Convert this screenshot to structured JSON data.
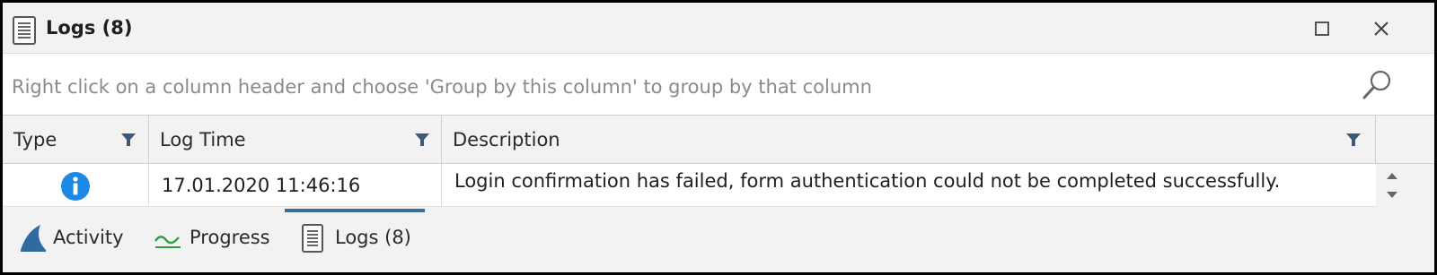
{
  "window": {
    "title": "Logs (8)",
    "icons": {
      "title": "document-lines-icon",
      "maximize": "maximize-icon",
      "close": "close-icon"
    }
  },
  "group_panel": {
    "hint": "Right click on a column header and choose 'Group by this column' to group by that column",
    "search_icon": "search-icon"
  },
  "grid": {
    "columns": [
      {
        "label": "Type",
        "filter_icon": "filter-icon"
      },
      {
        "label": "Log Time",
        "filter_icon": "filter-icon"
      },
      {
        "label": "Description",
        "filter_icon": "filter-icon"
      }
    ],
    "rows": [
      {
        "type_icon": "info-icon",
        "log_time": "17.01.2020 11:46:16",
        "description": "Login confirmation has failed, form authentication could not be completed successfully."
      }
    ]
  },
  "tabs": [
    {
      "label": "Activity",
      "icon": "shark-fin-icon",
      "selected": false
    },
    {
      "label": "Progress",
      "icon": "progress-wave-icon",
      "selected": false
    },
    {
      "label": "Logs (8)",
      "icon": "document-lines-icon",
      "selected": true
    }
  ],
  "colors": {
    "accent": "#3c6e9a",
    "info": "#1e88e5",
    "progress": "#2e9e44"
  }
}
